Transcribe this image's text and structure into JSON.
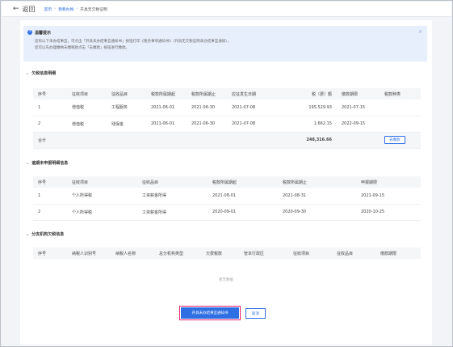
{
  "header": {
    "back_label": "返回",
    "breadcrumb": [
      "首页",
      "我要办税",
      "开具无欠税证明"
    ]
  },
  "notice": {
    "title": "温馨提示",
    "line1": "您有以下未办结事宜，可点击「开具未办结事宜通知书」按钮打印《税务事项通知书》（开具无欠税证明未办结事宜通知），",
    "line2": "您可以先办理缴纳未缴税款点击「去缴款」按钮进行缴款。",
    "close": "×"
  },
  "unpaid": {
    "title": "欠税信息明细",
    "headers": [
      "序号",
      "征收项目",
      "征收品目",
      "税款所属期起",
      "税款所属期止",
      "应征发生日期",
      "税（费）额",
      "缴款期限",
      "税款种类"
    ],
    "rows": [
      [
        "1",
        "增值税",
        "工程服务",
        "2021-06-01",
        "2021-06-30",
        "2021-07-08",
        "195,529.93",
        "2021-07-15",
        ""
      ],
      [
        "2",
        "增值税",
        "残保金",
        "2021-06-01",
        "2021-06-30",
        "2021-07-08",
        "1,662.15",
        "2022-09-15",
        ""
      ]
    ],
    "total_label": "合计",
    "total_value": "248,316.66",
    "pay_button": "去缴款"
  },
  "overdue": {
    "title": "逾期未申报明细信息",
    "headers": [
      "序号",
      "征收项目",
      "征收品目",
      "税款所属期起",
      "税款所属期止",
      "申报期限"
    ],
    "rows": [
      [
        "1",
        "个人所得税",
        "工资薪金所得",
        "2021-08-01",
        "2021-08-31",
        "2021-09-15"
      ],
      [
        "2",
        "个人所得税",
        "工资薪金所得",
        "2020-09-01",
        "2020-09-30",
        "2020-10-25"
      ]
    ]
  },
  "branch": {
    "title": "分支机构欠税信息",
    "headers": [
      "序号",
      "纳税人识别号",
      "纳税人名称",
      "总分机构类型",
      "欠费税款",
      "管本行政区",
      "征收项目",
      "征收品目",
      "缴款期限"
    ],
    "empty_text": "暂无数据"
  },
  "actions": {
    "primary": "开具未办结事宜通知书",
    "cancel": "取消"
  },
  "colors": {
    "accent": "#2f6fe4",
    "highlight": "#e8206c"
  }
}
